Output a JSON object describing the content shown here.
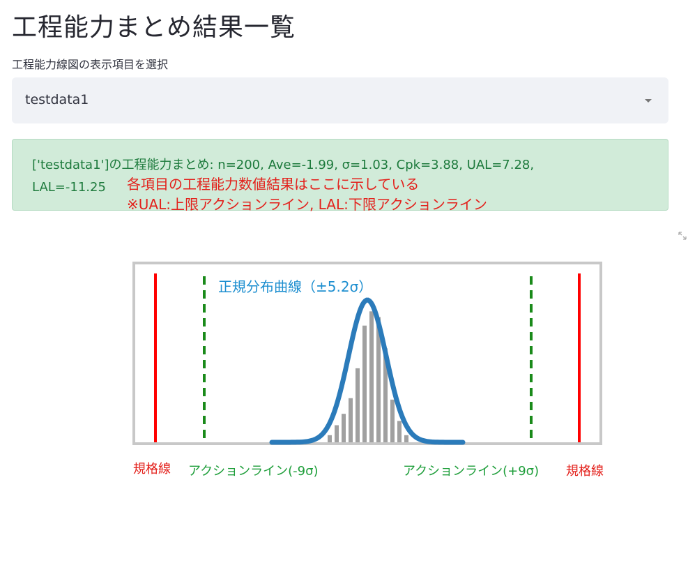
{
  "page": {
    "title": "工程能力まとめ結果一覧"
  },
  "selector": {
    "label": "工程能力線図の表示項目を選択",
    "selected": "testdata1"
  },
  "summary": {
    "line1": "['testdata1']の工程能力まとめ:  n=200, Ave=-1.99, σ=1.03, Cpk=3.88, UAL=7.28,",
    "line2": "LAL=-11.25",
    "note1": "各項目の工程能力数値結果はここに示している",
    "note2": "※UAL:上限アクションライン, LAL:下限アクションライン"
  },
  "chart_data": {
    "type": "bar",
    "curve_label": "正規分布曲線（±5.2σ）",
    "spec_line_label_left": "規格線",
    "spec_line_label_right": "規格線",
    "action_line_label_left": "アクションライン(-9σ)",
    "action_line_label_right": "アクションライン(+9σ)",
    "histogram_values": [
      0.05,
      0.12,
      0.2,
      0.31,
      0.52,
      0.82,
      0.92,
      0.88,
      0.66,
      0.3,
      0.15,
      0.05
    ],
    "colors": {
      "spec_line": "#ff0000",
      "action_line": "#1a8a1a",
      "curve": "#2b7bba",
      "bars": "#a0a0a0",
      "frame": "#c8c8c8"
    }
  },
  "icons": {
    "expand": "fullscreen-expand-icon"
  }
}
